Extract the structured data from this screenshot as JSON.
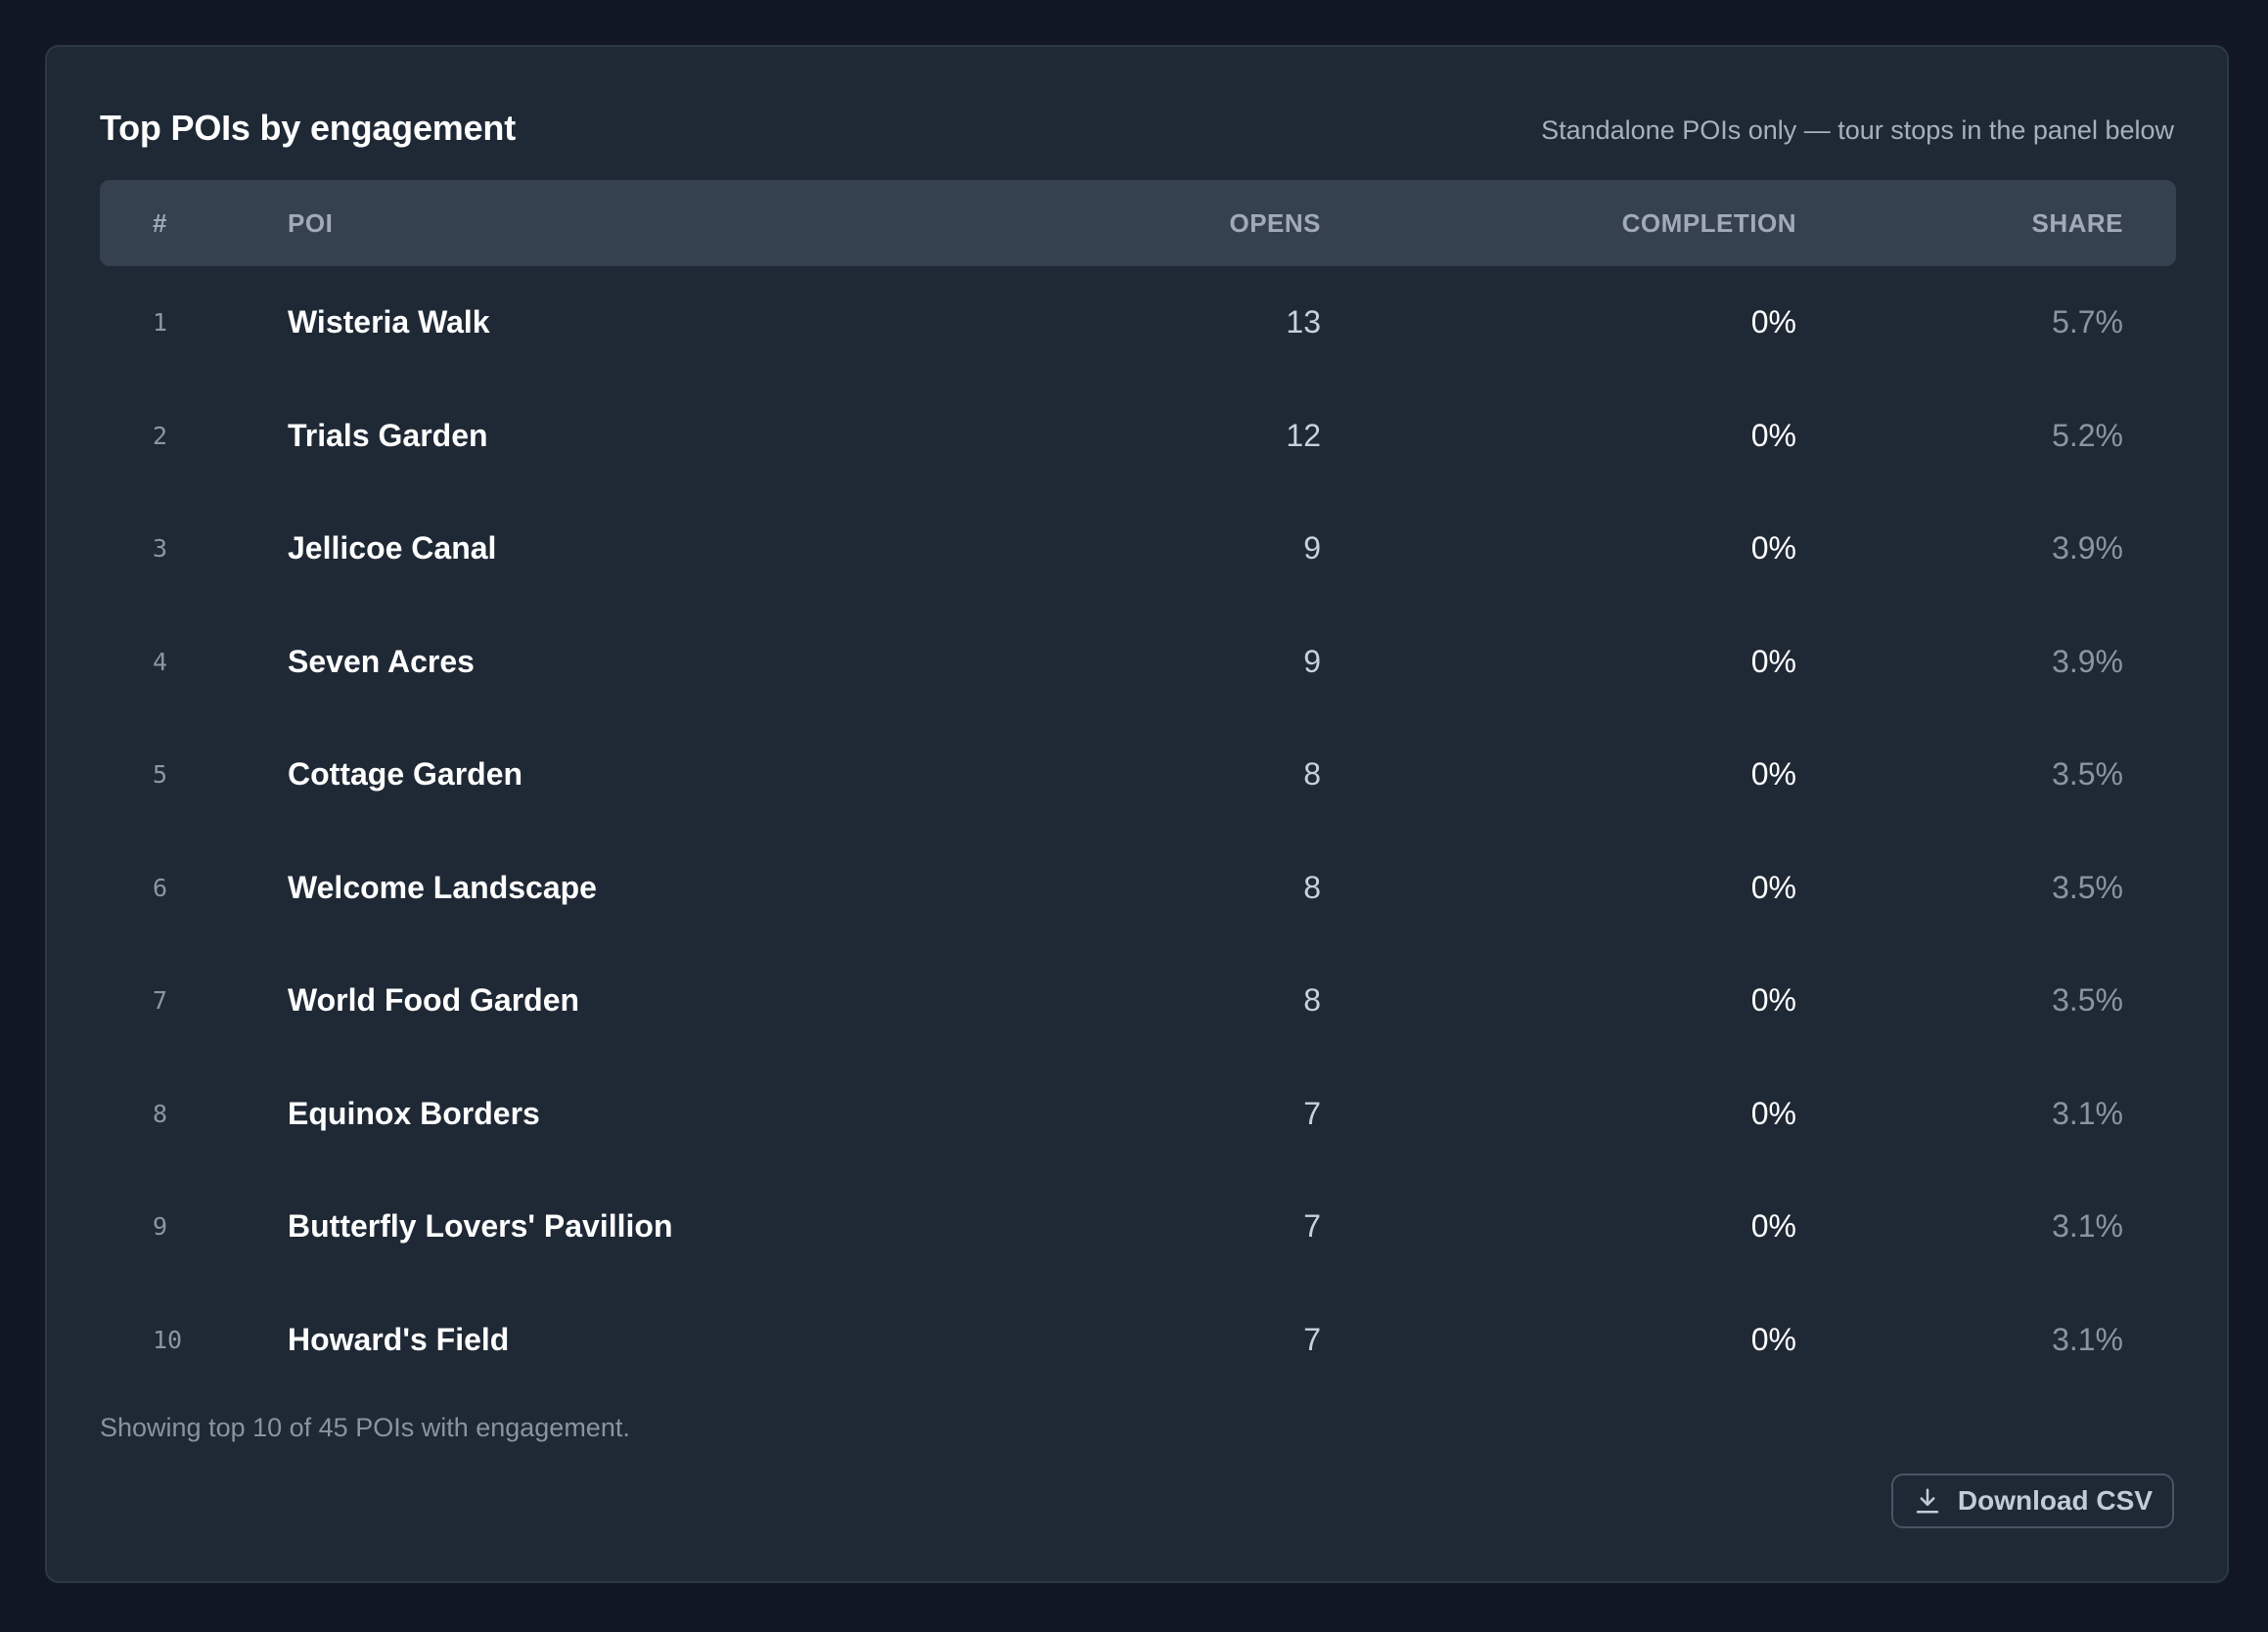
{
  "panel": {
    "title": "Top POIs by engagement",
    "subtitle": "Standalone POIs only — tour stops in the panel below"
  },
  "table": {
    "headers": {
      "rank": "#",
      "poi": "POI",
      "opens": "OPENS",
      "completion": "COMPLETION",
      "share": "SHARE"
    },
    "rows": [
      {
        "rank": "1",
        "poi": "Wisteria Walk",
        "opens": "13",
        "completion": "0%",
        "share": "5.7%"
      },
      {
        "rank": "2",
        "poi": "Trials Garden",
        "opens": "12",
        "completion": "0%",
        "share": "5.2%"
      },
      {
        "rank": "3",
        "poi": "Jellicoe Canal",
        "opens": "9",
        "completion": "0%",
        "share": "3.9%"
      },
      {
        "rank": "4",
        "poi": "Seven Acres",
        "opens": "9",
        "completion": "0%",
        "share": "3.9%"
      },
      {
        "rank": "5",
        "poi": "Cottage Garden",
        "opens": "8",
        "completion": "0%",
        "share": "3.5%"
      },
      {
        "rank": "6",
        "poi": "Welcome Landscape",
        "opens": "8",
        "completion": "0%",
        "share": "3.5%"
      },
      {
        "rank": "7",
        "poi": "World Food Garden",
        "opens": "8",
        "completion": "0%",
        "share": "3.5%"
      },
      {
        "rank": "8",
        "poi": "Equinox Borders",
        "opens": "7",
        "completion": "0%",
        "share": "3.1%"
      },
      {
        "rank": "9",
        "poi": "Butterfly Lovers' Pavillion",
        "opens": "7",
        "completion": "0%",
        "share": "3.1%"
      },
      {
        "rank": "10",
        "poi": "Howard's Field",
        "opens": "7",
        "completion": "0%",
        "share": "3.1%"
      }
    ]
  },
  "footer": {
    "note": "Showing top 10 of 45 POIs with engagement.",
    "download_label": "Download CSV",
    "download_icon": "download-icon"
  },
  "colors": {
    "page_background": "#111824",
    "panel_background": "#1f2935",
    "header_row_background": "#36414f",
    "primary_text": "#ffffff",
    "muted_text": "#8b95a2"
  }
}
